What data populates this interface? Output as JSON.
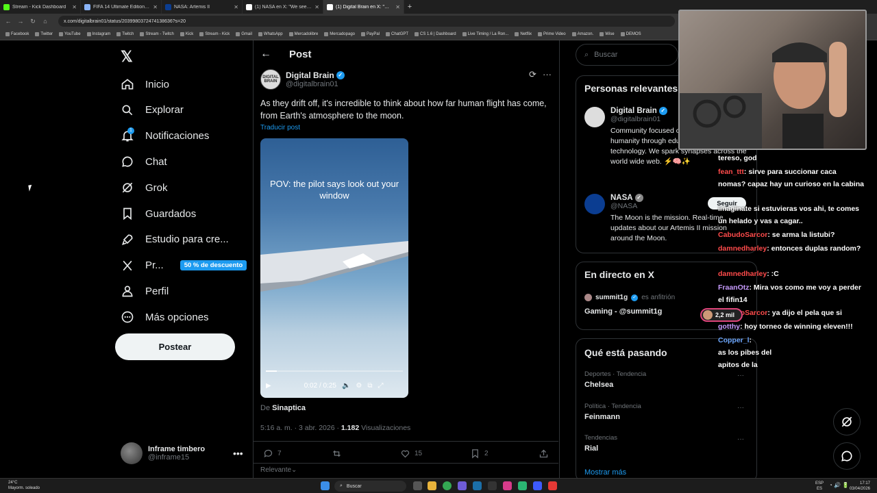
{
  "browser": {
    "tabs": [
      {
        "title": "Stream - Kick Dashboard",
        "icon": "kick-icon",
        "color": "#53fc18",
        "active": false
      },
      {
        "title": "FIFA 14 Ultimate Edition - Dow",
        "icon": "globe-icon",
        "color": "#8ab4f8",
        "active": false
      },
      {
        "title": "NASA: Artemis II",
        "icon": "nasa-icon",
        "color": "#0b3d91",
        "active": false
      },
      {
        "title": "(1) NASA en X: \"We see our ho",
        "icon": "x-icon",
        "color": "#ffffff",
        "active": false
      },
      {
        "title": "(1) Digital Brain en X: \"@NASA",
        "icon": "x-icon",
        "color": "#ffffff",
        "active": true
      }
    ],
    "url": "x.com/digitalbrain01/status/2039980372474138636?s=20",
    "bookmarks": [
      "Facebook",
      "Twitter",
      "YouTube",
      "Instagram",
      "Twitch",
      "Stream - Twitch",
      "Kick",
      "Stream - Kick",
      "Gmail",
      "WhatsApp",
      "Mercadolibre",
      "Mercadopago",
      "PayPal",
      "ChatGPT",
      "CS 1.6 | Dashboard",
      "Live Timing / La Ron...",
      "Netflix",
      "Prime Video",
      "Amazon.",
      "Wise",
      "DEMOS"
    ]
  },
  "sidebar": {
    "items": [
      {
        "label": "Inicio",
        "icon": "home-icon"
      },
      {
        "label": "Explorar",
        "icon": "search-icon"
      },
      {
        "label": "Notificaciones",
        "icon": "bell-icon",
        "badge": "1"
      },
      {
        "label": "Chat",
        "icon": "chat-icon"
      },
      {
        "label": "Grok",
        "icon": "grok-icon"
      },
      {
        "label": "Guardados",
        "icon": "bookmark-icon"
      },
      {
        "label": "Estudio para cre...",
        "icon": "rocket-icon"
      },
      {
        "label": "Pr...",
        "icon": "x-premium-icon",
        "promo": "50 % de descuento"
      },
      {
        "label": "Perfil",
        "icon": "person-icon"
      },
      {
        "label": "Más opciones",
        "icon": "more-circle-icon"
      }
    ],
    "post_button": "Postear",
    "user": {
      "name": "Inframe timbero",
      "handle": "@inframe15"
    }
  },
  "post": {
    "header_title": "Post",
    "author": {
      "name": "Digital Brain",
      "handle": "@digitalbrain01",
      "avatar_text": "DIGITAL BRAIN"
    },
    "text": "As they drift off, it's incredible to think about how far human flight has come, from Earth's atmosphere to the moon.",
    "translate": "Traducir post",
    "video": {
      "caption": "POV: the pilot says look out your window",
      "time": "0:02 / 0:25",
      "progress": 0.08
    },
    "source_prefix": "De",
    "source_name": "Sinaptica",
    "timestamp": "5:16 a. m. · 3 abr. 2026 ·",
    "views_count": "1.182",
    "views_label": "Visualizaciones",
    "replies": "7",
    "reposts": "",
    "likes": "15",
    "bookmarks": "2",
    "sort_label": "Relevante"
  },
  "right": {
    "search_placeholder": "Buscar",
    "relevant_title": "Personas relevantes",
    "people": [
      {
        "name": "Digital Brain",
        "handle": "@digitalbrain01",
        "bio": "Community focused on the development of humanity through education, science, and technology. We spark synapses across the world wide web. ⚡🧠✨"
      },
      {
        "name": "NASA",
        "handle": "@NASA",
        "bio": "The Moon is the mission. Real-time updates about our Artemis II mission around the Moon.",
        "follow": "Seguir"
      }
    ],
    "live_title": "En directo en X",
    "live": {
      "user": "summit1g",
      "role": "es anfitrión",
      "title": "Gaming - @summit1g"
    },
    "trends_title": "Qué está pasando",
    "trends": [
      {
        "context": "Deportes · Tendencia",
        "name": "Chelsea"
      },
      {
        "context": "Política · Tendencia",
        "name": "Feinmann"
      },
      {
        "context": "Tendencias",
        "name": "Rial"
      }
    ],
    "show_more": "Mostrar más"
  },
  "chat": [
    {
      "user": "",
      "msg": "tereso, god",
      "color": "#ffffff"
    },
    {
      "user": "fean_ttt",
      "msg": ": sirve para succionar caca nomas? capaz hay un curioso en la cabina",
      "color": "#ff4b4b"
    },
    {
      "user": "",
      "msg": "imaginate si estuvieras vos ahi, te comes un helado y vas a cagar..",
      "color": "#ffffff"
    },
    {
      "user": "CabudoSarcor",
      "msg": ": se arma la listubi?",
      "color": "#ff4b4b"
    },
    {
      "user": "damnedharley",
      "msg": ": entonces duplas random?",
      "color": "#ff4b4b"
    },
    {
      "user": "damnedharley",
      "msg": ": :C",
      "color": "#ff4b4b"
    },
    {
      "user": "FraanOtz",
      "msg": ": Mira vos como me voy a perder el fifin14",
      "color": "#c89cff"
    },
    {
      "user": "CabudoSarcor",
      "msg": ": ya dijo el pela que si",
      "color": "#ff4b4b"
    },
    {
      "user": "gotthy",
      "msg": ": hoy torneo de winning eleven!!!",
      "color": "#c89cff"
    },
    {
      "user": "Copper_l",
      "msg": ":",
      "color": "#6ea8ff"
    },
    {
      "user": "",
      "msg": "as los pibes del apitos de la",
      "color": "#ffffff"
    }
  ],
  "chat_viewers": "2,2 mil",
  "taskbar": {
    "weather_temp": "24°C",
    "weather_desc": "Mayorm. soleado",
    "search": "Buscar",
    "lang1": "ESP",
    "lang2": "ES",
    "time": "17:17",
    "date": "03/04/2026"
  }
}
